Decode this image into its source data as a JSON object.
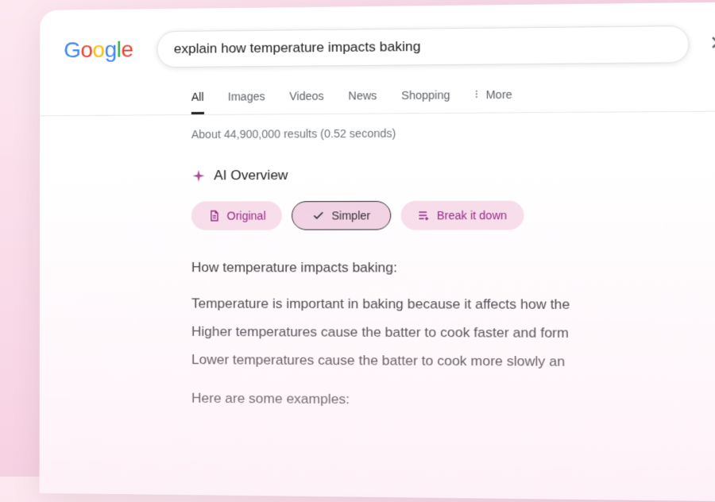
{
  "logo_letters": {
    "g1": "G",
    "o1": "o",
    "o2": "o",
    "g2": "g",
    "l": "l",
    "e": "e"
  },
  "search": {
    "value": "explain how temperature impacts baking"
  },
  "tabs": {
    "all": "All",
    "images": "Images",
    "videos": "Videos",
    "news": "News",
    "shopping": "Shopping",
    "more": "More"
  },
  "results_stats": "About 44,900,000 results (0.52 seconds)",
  "ai": {
    "title": "AI Overview",
    "chips": {
      "original": "Original",
      "simpler": "Simpler",
      "break": "Break it down"
    },
    "answer": {
      "intro": "How temperature impacts baking:",
      "l1": "Temperature is important in baking because it affects how the",
      "l2": "Higher temperatures cause the batter to cook faster and form",
      "l3": "Lower temperatures cause the batter to cook more slowly an",
      "l4": "Here are some examples:"
    }
  }
}
